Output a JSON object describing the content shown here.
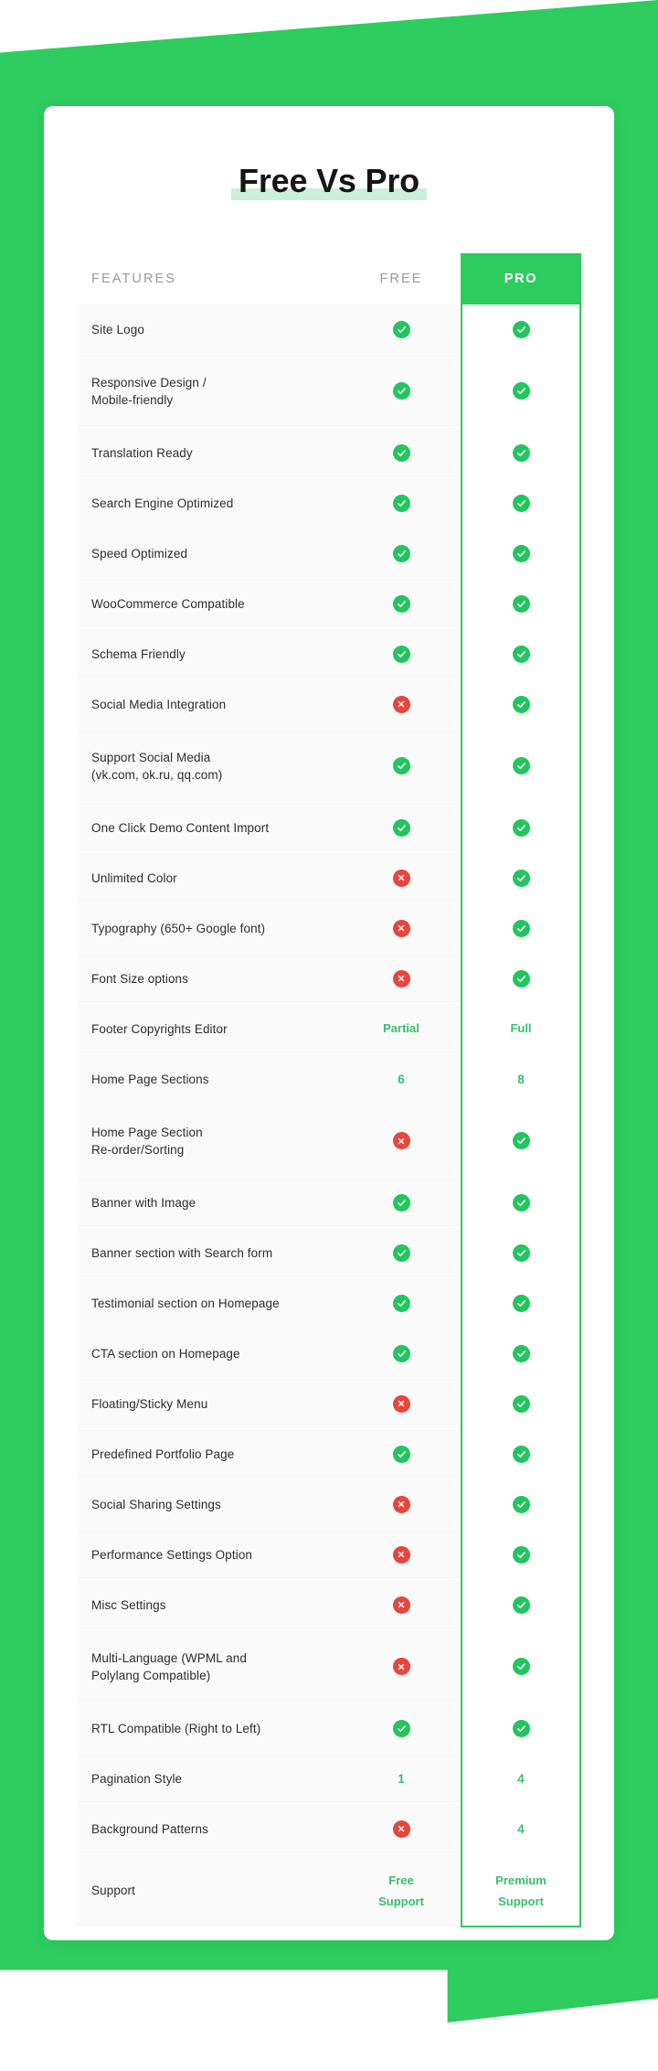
{
  "title": "Free Vs Pro",
  "colors": {
    "brand_green": "#2ecc5e",
    "check_green": "#22c55e",
    "cross_red": "#e8453c",
    "value_green": "#36c06a",
    "title_highlight": "#cdeedb",
    "row_background": "#fafafa",
    "card_background": "#ffffff",
    "header_text": "#9a9a9a",
    "feature_text": "#2d2d2d"
  },
  "table": {
    "columns": [
      {
        "key": "features",
        "label": "FEATURES"
      },
      {
        "key": "free",
        "label": "FREE"
      },
      {
        "key": "pro",
        "label": "PRO"
      }
    ],
    "rows": [
      {
        "feature": "Site Logo",
        "free": {
          "type": "check",
          "value": "check-circle-icon"
        },
        "pro": {
          "type": "check",
          "value": "check-circle-icon"
        },
        "lines": 1
      },
      {
        "feature": "Responsive Design /\nMobile-friendly",
        "free": {
          "type": "check",
          "value": "check-circle-icon"
        },
        "pro": {
          "type": "check",
          "value": "check-circle-icon"
        },
        "lines": 2
      },
      {
        "feature": "Translation Ready",
        "free": {
          "type": "check",
          "value": "check-circle-icon"
        },
        "pro": {
          "type": "check",
          "value": "check-circle-icon"
        },
        "lines": 1
      },
      {
        "feature": "Search Engine Optimized",
        "free": {
          "type": "check",
          "value": "check-circle-icon"
        },
        "pro": {
          "type": "check",
          "value": "check-circle-icon"
        },
        "lines": 1
      },
      {
        "feature": "Speed Optimized",
        "free": {
          "type": "check",
          "value": "check-circle-icon"
        },
        "pro": {
          "type": "check",
          "value": "check-circle-icon"
        },
        "lines": 1
      },
      {
        "feature": "WooCommerce Compatible",
        "free": {
          "type": "check",
          "value": "check-circle-icon"
        },
        "pro": {
          "type": "check",
          "value": "check-circle-icon"
        },
        "lines": 1
      },
      {
        "feature": "Schema Friendly",
        "free": {
          "type": "check",
          "value": "check-circle-icon"
        },
        "pro": {
          "type": "check",
          "value": "check-circle-icon"
        },
        "lines": 1
      },
      {
        "feature": "Social Media Integration",
        "free": {
          "type": "cross",
          "value": "cross-circle-icon"
        },
        "pro": {
          "type": "check",
          "value": "check-circle-icon"
        },
        "lines": 1
      },
      {
        "feature": "Support Social Media\n(vk.com, ok.ru, qq.com)",
        "free": {
          "type": "check",
          "value": "check-circle-icon"
        },
        "pro": {
          "type": "check",
          "value": "check-circle-icon"
        },
        "lines": 2
      },
      {
        "feature": "One Click Demo Content Import",
        "free": {
          "type": "check",
          "value": "check-circle-icon"
        },
        "pro": {
          "type": "check",
          "value": "check-circle-icon"
        },
        "lines": 1
      },
      {
        "feature": "Unlimited Color",
        "free": {
          "type": "cross",
          "value": "cross-circle-icon"
        },
        "pro": {
          "type": "check",
          "value": "check-circle-icon"
        },
        "lines": 1
      },
      {
        "feature": "Typography (650+ Google font)",
        "free": {
          "type": "cross",
          "value": "cross-circle-icon"
        },
        "pro": {
          "type": "check",
          "value": "check-circle-icon"
        },
        "lines": 1
      },
      {
        "feature": "Font Size options",
        "free": {
          "type": "cross",
          "value": "cross-circle-icon"
        },
        "pro": {
          "type": "check",
          "value": "check-circle-icon"
        },
        "lines": 1
      },
      {
        "feature": "Footer Copyrights Editor",
        "free": {
          "type": "text",
          "value": "Partial"
        },
        "pro": {
          "type": "text",
          "value": "Full"
        },
        "lines": 1
      },
      {
        "feature": "Home Page Sections",
        "free": {
          "type": "text",
          "value": "6"
        },
        "pro": {
          "type": "text",
          "value": "8"
        },
        "lines": 1
      },
      {
        "feature": "Home Page Section\nRe-order/Sorting",
        "free": {
          "type": "cross",
          "value": "cross-circle-icon"
        },
        "pro": {
          "type": "check",
          "value": "check-circle-icon"
        },
        "lines": 2
      },
      {
        "feature": "Banner with Image",
        "free": {
          "type": "check",
          "value": "check-circle-icon"
        },
        "pro": {
          "type": "check",
          "value": "check-circle-icon"
        },
        "lines": 1
      },
      {
        "feature": "Banner section with Search form",
        "free": {
          "type": "check",
          "value": "check-circle-icon"
        },
        "pro": {
          "type": "check",
          "value": "check-circle-icon"
        },
        "lines": 1
      },
      {
        "feature": "Testimonial section on Homepage",
        "free": {
          "type": "check",
          "value": "check-circle-icon"
        },
        "pro": {
          "type": "check",
          "value": "check-circle-icon"
        },
        "lines": 1
      },
      {
        "feature": "CTA section on Homepage",
        "free": {
          "type": "check",
          "value": "check-circle-icon"
        },
        "pro": {
          "type": "check",
          "value": "check-circle-icon"
        },
        "lines": 1
      },
      {
        "feature": "Floating/Sticky Menu",
        "free": {
          "type": "cross",
          "value": "cross-circle-icon"
        },
        "pro": {
          "type": "check",
          "value": "check-circle-icon"
        },
        "lines": 1
      },
      {
        "feature": "Predefined Portfolio Page",
        "free": {
          "type": "check",
          "value": "check-circle-icon"
        },
        "pro": {
          "type": "check",
          "value": "check-circle-icon"
        },
        "lines": 1
      },
      {
        "feature": "Social Sharing Settings",
        "free": {
          "type": "cross",
          "value": "cross-circle-icon"
        },
        "pro": {
          "type": "check",
          "value": "check-circle-icon"
        },
        "lines": 1
      },
      {
        "feature": "Performance Settings Option",
        "free": {
          "type": "cross",
          "value": "cross-circle-icon"
        },
        "pro": {
          "type": "check",
          "value": "check-circle-icon"
        },
        "lines": 1
      },
      {
        "feature": "Misc Settings",
        "free": {
          "type": "cross",
          "value": "cross-circle-icon"
        },
        "pro": {
          "type": "check",
          "value": "check-circle-icon"
        },
        "lines": 1
      },
      {
        "feature": "Multi-Language (WPML and\nPolylang Compatible)",
        "free": {
          "type": "cross",
          "value": "cross-circle-icon"
        },
        "pro": {
          "type": "check",
          "value": "check-circle-icon"
        },
        "lines": 2
      },
      {
        "feature": "RTL Compatible (Right to Left)",
        "free": {
          "type": "check",
          "value": "check-circle-icon"
        },
        "pro": {
          "type": "check",
          "value": "check-circle-icon"
        },
        "lines": 1
      },
      {
        "feature": "Pagination Style",
        "free": {
          "type": "text",
          "value": "1"
        },
        "pro": {
          "type": "text",
          "value": "4"
        },
        "lines": 1
      },
      {
        "feature": "Background Patterns",
        "free": {
          "type": "cross",
          "value": "cross-circle-icon"
        },
        "pro": {
          "type": "text",
          "value": "4"
        },
        "lines": 1
      },
      {
        "feature": "Support",
        "free": {
          "type": "text",
          "value": "Free\nSupport"
        },
        "pro": {
          "type": "text",
          "value": "Premium\nSupport"
        },
        "lines": 2
      }
    ]
  }
}
